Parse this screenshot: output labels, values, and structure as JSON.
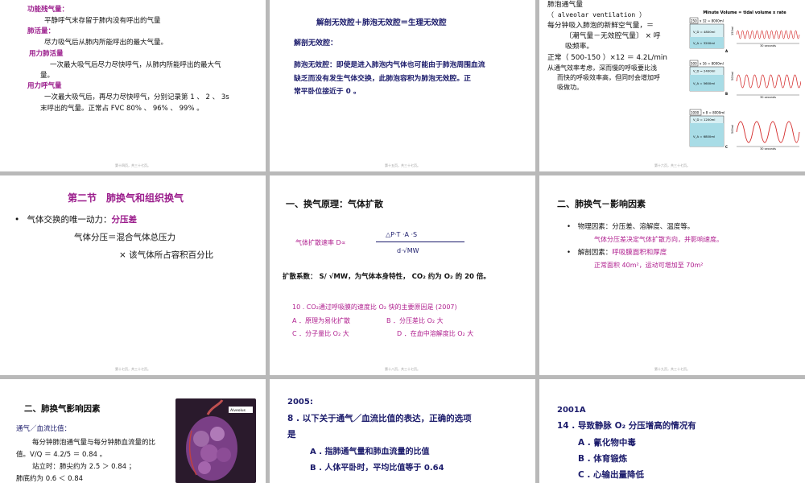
{
  "slides": {
    "s1": {
      "lines": [
        "功能残气量：",
        "平静呼气末存留于肺内没有呼出的气量",
        "肺活量：",
        "尽力吸气后从肺内所能呼出的最大气量。",
        "用力肺活量",
        "一次最大吸气后尽力尽快呼气，从肺内所能呼出的最大气",
        "量。",
        "用力呼气量",
        "一次最大吸气后，再尽力尽快呼气，分别记录第 1 、 2 、 3s",
        "末呼出的气量。正常占 FVC 80% 、 96% 、 99% 。"
      ],
      "footer": "第十四页，共三十七页。"
    },
    "s2": {
      "title": "解剖无效腔＋肺泡无效腔＝生理无效腔",
      "subtitle": "解剖无效腔：",
      "body": [
        "肺泡无效腔：即使是进入肺泡内气体也可能由于肺泡周围血流",
        "缺乏而没有发生气体交换，此肺泡容积为肺泡无效腔。正",
        "常平卧位接近于 0 。"
      ],
      "footer": "第十五页，共三十七页。"
    },
    "s3": {
      "lines": [
        "肺泡通气量",
        "（ alveolar ventilation ）",
        "每分钟吸入肺泡的新鲜空气量，＝",
        "〔潮气量－无效腔气量〕 × 呼",
        "吸频率。",
        "正常（ 500-150 ）×12 ＝ 4.2L/min",
        "从通气效率考虑，深而慢的呼吸要比浅",
        "而快的呼吸效率高，但同时会增加呼",
        "吸做功。"
      ],
      "chart_title": "Minute Volume = tidal volume x rate",
      "panels": [
        {
          "tidal": "250",
          "minute": "x 32 = 8000ml",
          "vd": "V_D = 4800ml",
          "va": "V_A = 3200ml",
          "label": "A",
          "side": "150ml",
          "time": "30 seconds"
        },
        {
          "tidal": "500",
          "minute": "x 16 = 8000ml",
          "vd": "V_D = 2400ml",
          "va": "V_A = 5600ml",
          "label": "B",
          "side": "500ml",
          "time": "30 seconds"
        },
        {
          "tidal": "1000",
          "minute": "x 8 = 8000ml",
          "vd": "V_D = 1200ml",
          "va": "V_A = 6800ml",
          "label": "C",
          "side": "500ml",
          "time": "30 seconds"
        }
      ],
      "footer": "第十六页，共三十七页。"
    },
    "s4": {
      "title": "第二节　肺换气和组织换气",
      "bullet": "气体交换的唯一动力：",
      "bullet_em": "分压差",
      "line2": "气体分压＝混合气体总压力",
      "line3": "× 该气体所占容积百分比",
      "footer": "第十七页，共三十七页。"
    },
    "s5": {
      "title": "一、换气原理：气体扩散",
      "formula_label": "气体扩散速率 D∝",
      "numerator": "△P·T ·A ·S",
      "denominator": "d·√MW",
      "coef": "扩散系数： S/ √MW，为气体本身特性， CO₂ 约为 O₂ 的 20 倍。",
      "question": "10 . CO₂通过呼吸膜的速度比 O₂ 快的主要原因是 (2007)",
      "optA": "A ．原理为易化扩散",
      "optB": "B ．分压差比 O₂ 大",
      "optC": "C ．分子量比 O₂  大",
      "optD": "D ．在血中溶解度比 O₂  大",
      "footer": "第十八页，共三十七页。"
    },
    "s6": {
      "title": "二、肺换气－影响因素",
      "b1": "物理因素：分压差、溶解度、温度等。",
      "b1sub": "气体分压差决定气体扩散方向，并影响速度。",
      "b2_pre": "解剖因素：",
      "b2": "呼吸膜面积和厚度",
      "b2sub": "正常面积 40m²，运动可增加至 70m²",
      "footer": "第十九页，共三十七页。"
    },
    "s7": {
      "title": "二、肺换气影响因素",
      "sub": "通气／血流比值：",
      "l1": "每分钟肺泡通气量与每分钟肺血流量的比",
      "l2": "值。V/Q ＝ 4.2/5 ＝ 0.84 。",
      "l3": "站立时：肺尖约为 2.5 ＞ 0.84 ；",
      "l4": "肺底约为 0.6 ＜ 0.84",
      "img_label": "Alveolus"
    },
    "s8": {
      "year": "2005:",
      "q": "8 . 以下关于通气／血流比值的表达，正确的选项",
      "q2": "是",
      "a": "A . 指肺通气量和肺血流量的比值",
      "b": "B . 人体平卧时，平均比值等于 0.64"
    },
    "s9": {
      "year": "2001A",
      "q": "14 . 导致静脉 O₂ 分压增高的情况有",
      "a": "A . 氰化物中毒",
      "b": "B . 体育锻炼",
      "c": "C . 心输出量降低"
    }
  }
}
